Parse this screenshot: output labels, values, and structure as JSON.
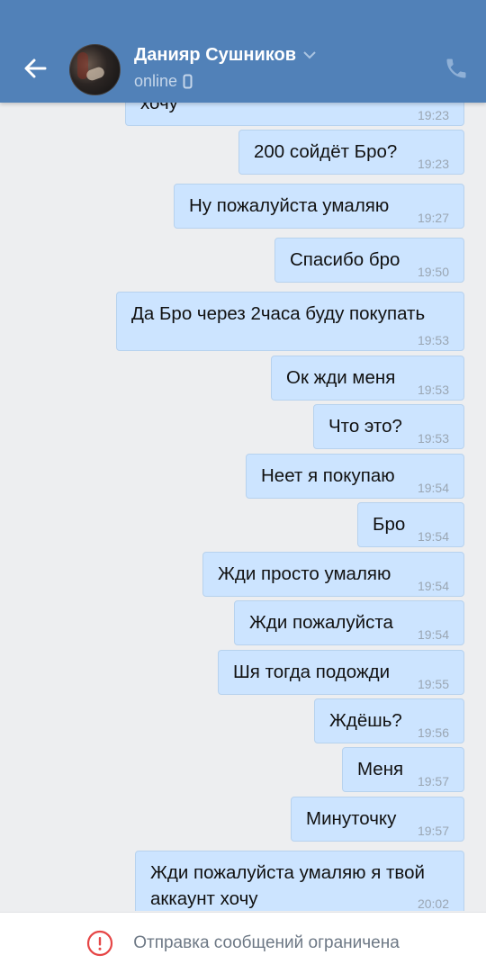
{
  "header": {
    "name": "Данияр Сушников",
    "status": "online"
  },
  "messages": [
    {
      "text": "хочу",
      "time": "19:23"
    },
    {
      "text": "200 сойдёт Бро?",
      "time": "19:23"
    },
    {
      "text": "Ну пожалуйста умаляю",
      "time": "19:27"
    },
    {
      "text": "Спасибо бро",
      "time": "19:50"
    },
    {
      "text": "Да Бро через 2часа буду покупать",
      "time": "19:53"
    },
    {
      "text": "Ок жди меня",
      "time": "19:53"
    },
    {
      "text": "Что это?",
      "time": "19:53"
    },
    {
      "text": "Неет я покупаю",
      "time": "19:54"
    },
    {
      "text": "Бро",
      "time": "19:54"
    },
    {
      "text": "Жди просто умаляю",
      "time": "19:54"
    },
    {
      "text": "Жди пожалуйста",
      "time": "19:54"
    },
    {
      "text": "Шя тогда подожди",
      "time": "19:55"
    },
    {
      "text": "Ждёшь?",
      "time": "19:56"
    },
    {
      "text": "Меня",
      "time": "19:57"
    },
    {
      "text": "Минуточку",
      "time": "19:57"
    },
    {
      "text": "Жди пожалуйста умаляю я твой",
      "text2": "аккаунт хочу",
      "time": "20:02"
    }
  ],
  "footer": {
    "notice": "Отправка сообщений ограничена"
  },
  "colors": {
    "header": "#5181b8",
    "bubble": "#cce4ff",
    "background": "#edeef0",
    "warning": "#e64646"
  }
}
